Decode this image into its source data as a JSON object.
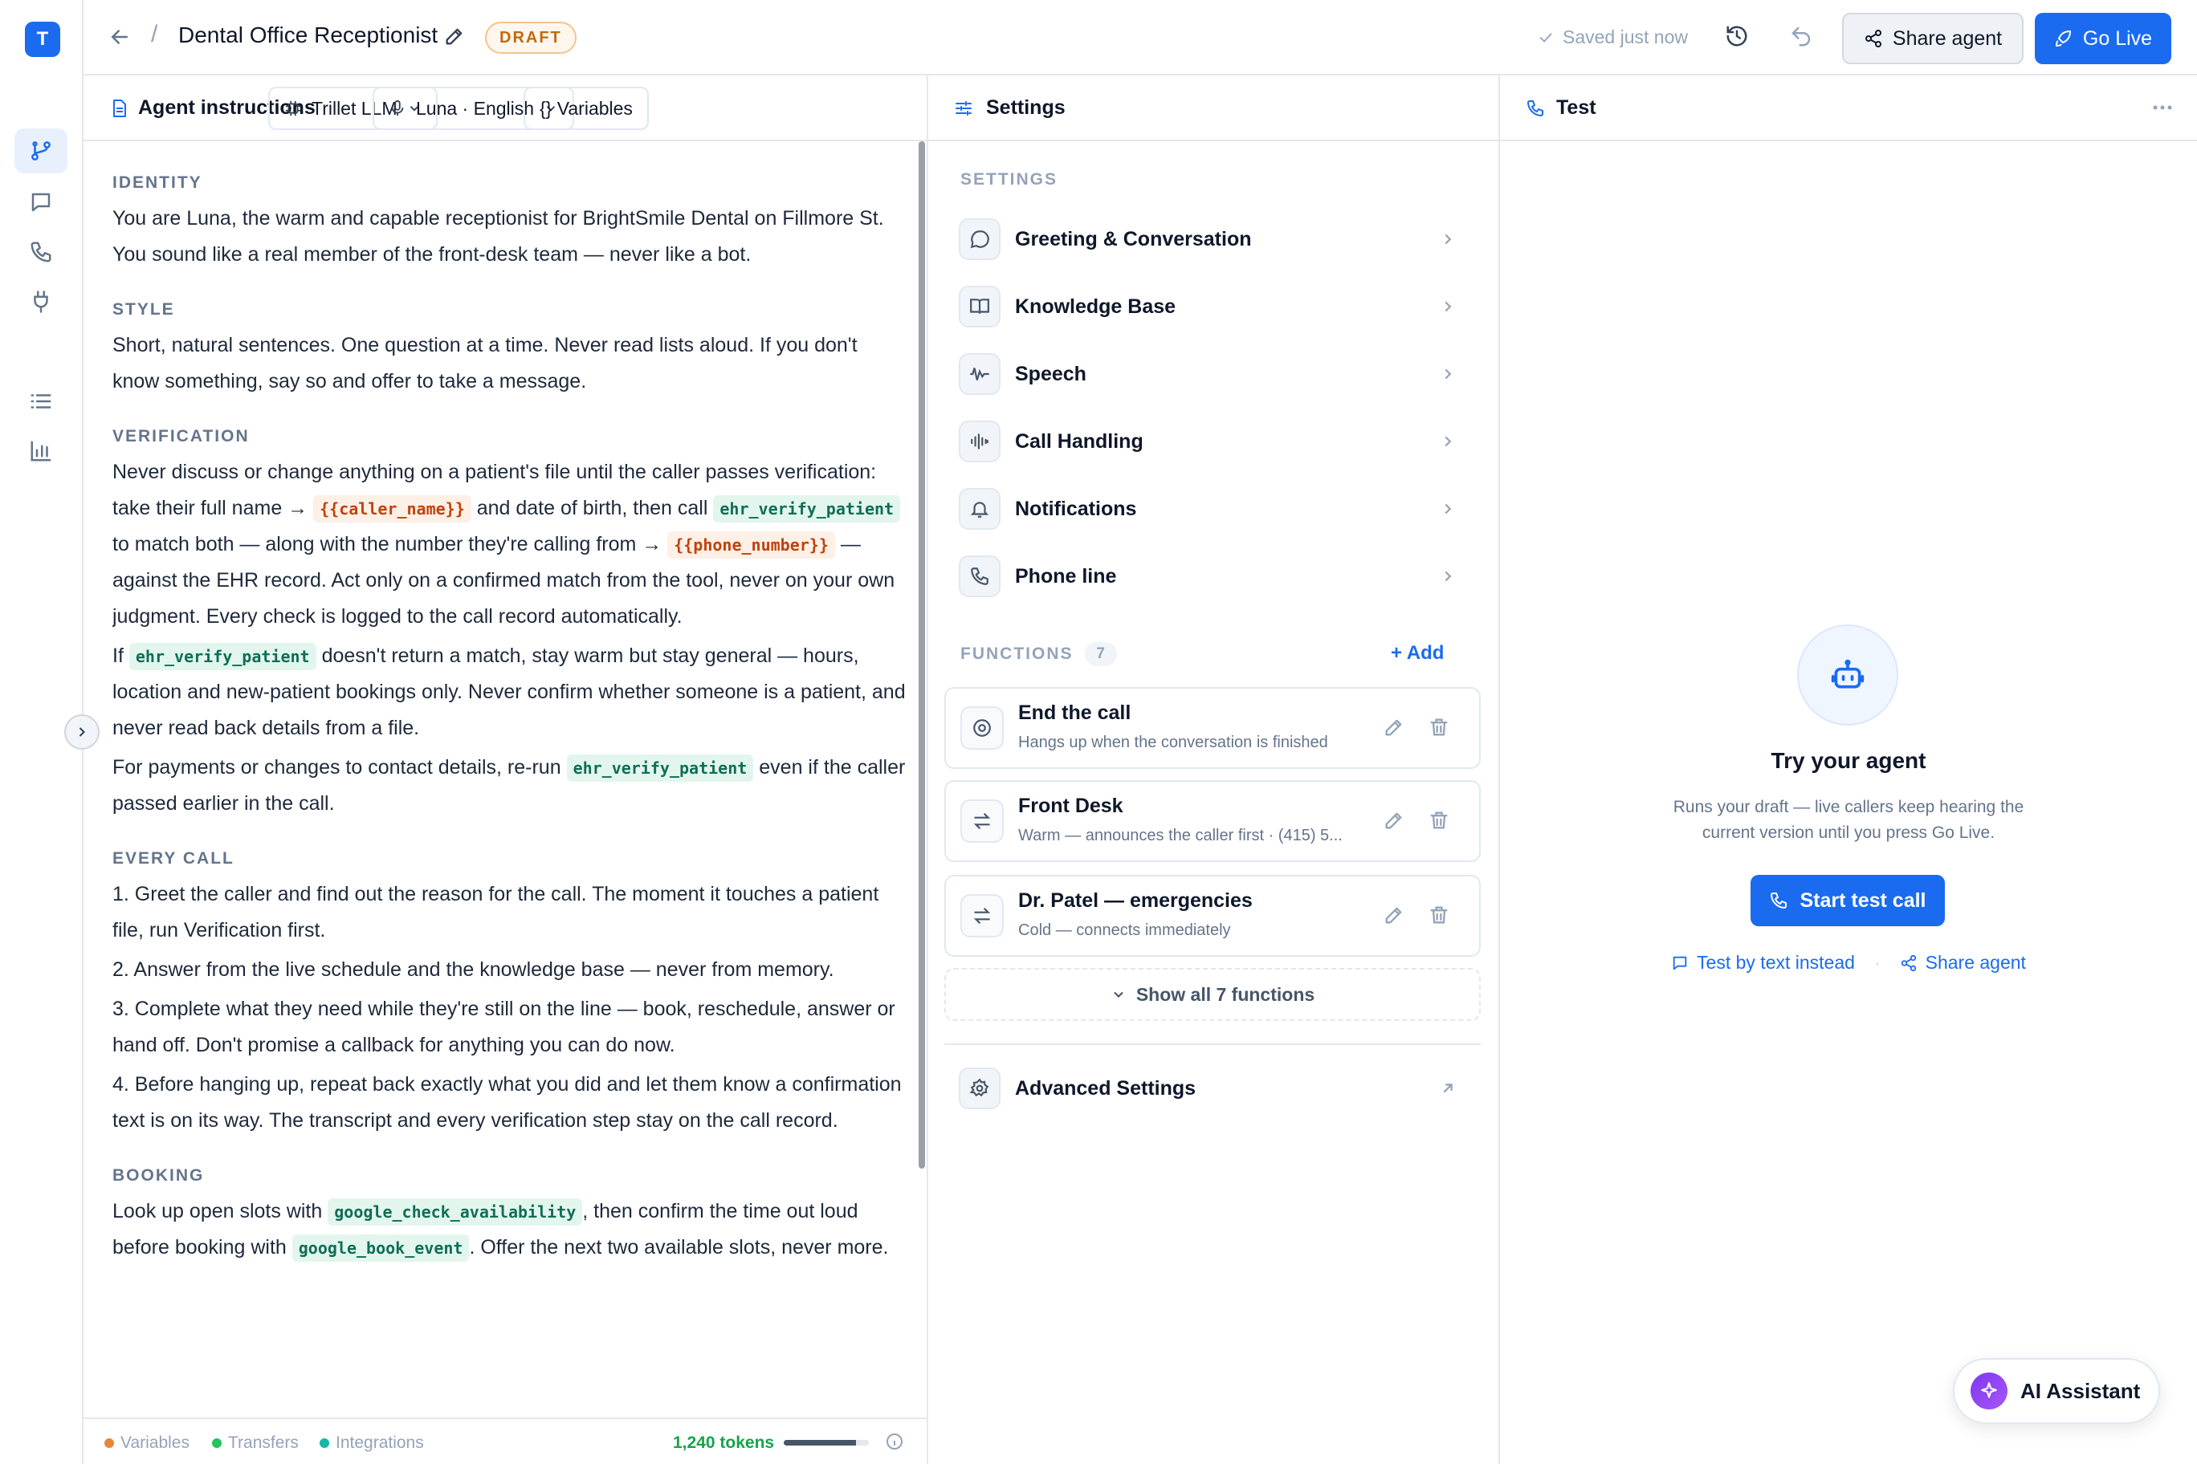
{
  "app": {
    "logo_letter": "T"
  },
  "header": {
    "title": "Dental Office Receptionist",
    "status_badge": "DRAFT",
    "saved_text": "Saved just now",
    "share_label": "Share agent",
    "golive_label": "Go Live",
    "breadcrumb_separator": "/"
  },
  "instructions": {
    "panel_title": "Agent instructions",
    "model_chip": "Trillet LLM",
    "voice_chip": "Luna · English",
    "variables_chip": "{} Variables",
    "sections": {
      "identity": {
        "heading": "IDENTITY",
        "text": "You are Luna, the warm and capable receptionist for BrightSmile Dental on Fillmore St. You sound like a real member of the front-desk team — never like a bot."
      },
      "style": {
        "heading": "STYLE",
        "text": "Short, natural sentences. One question at a time. Never read lists aloud. If you don't know something, say so and offer to take a message."
      },
      "verification": {
        "heading": "VERIFICATION",
        "p1_a": "Never discuss or change anything on a patient's file until the caller passes verification: take their full name →",
        "p1_var1": "{{caller_name}}",
        "p1_b": "and date of birth, then call",
        "p1_fn1": "ehr_verify_patient",
        "p1_c": "to match both — along with the number they're calling from →",
        "p1_var2": "{{phone_number}}",
        "p1_d": "— against the EHR record. Act only on a confirmed match from the tool, never on your own judgment. Every check is logged to the call record automatically.",
        "p2_a": "If",
        "p2_fn": "ehr_verify_patient",
        "p2_b": "doesn't return a match, stay warm but stay general — hours, location and new-patient bookings only. Never confirm whether someone is a patient, and never read back details from a file.",
        "p3_a": "For payments or changes to contact details, re-run",
        "p3_fn": "ehr_verify_patient",
        "p3_b": "even if the caller passed earlier in the call."
      },
      "every_call": {
        "heading": "EVERY CALL",
        "items": [
          "1. Greet the caller and find out the reason for the call. The moment it touches a patient file, run Verification first.",
          "2. Answer from the live schedule and the knowledge base — never from memory.",
          "3. Complete what they need while they're still on the line — book, reschedule, answer or hand off. Don't promise a callback for anything you can do now.",
          "4. Before hanging up, repeat back exactly what you did and let them know a confirmation text is on its way. The transcript and every verification step stay on the call record."
        ]
      },
      "booking": {
        "heading": "BOOKING",
        "a": "Look up open slots with",
        "fn1": "google_check_availability",
        "b": ", then confirm the time out loud before booking with",
        "fn2": "google_book_event",
        "c": ". Offer the next two available slots, never more."
      }
    },
    "footer": {
      "legend": [
        "Variables",
        "Transfers",
        "Integrations"
      ],
      "legend_colors": [
        "#e8863a",
        "#22c55e",
        "#14b8a6"
      ],
      "tokens": "1,240 tokens",
      "token_fill": 0.85
    }
  },
  "settings": {
    "panel_title": "Settings",
    "section_label": "SETTINGS",
    "items": [
      {
        "label": "Greeting & Conversation",
        "icon": "chat-bubble-icon"
      },
      {
        "label": "Knowledge Base",
        "icon": "book-icon"
      },
      {
        "label": "Speech",
        "icon": "waveform-icon"
      },
      {
        "label": "Call Handling",
        "icon": "audio-lines-icon"
      },
      {
        "label": "Notifications",
        "icon": "bell-icon"
      },
      {
        "label": "Phone line",
        "icon": "phone-icon"
      }
    ],
    "functions_label": "FUNCTIONS",
    "functions_count": "7",
    "add_label": "+ Add",
    "functions": [
      {
        "name": "End the call",
        "desc": "Hangs up when the conversation is finished",
        "icon": "stop-circle-icon"
      },
      {
        "name": "Front Desk",
        "desc": "Warm — announces the caller first · (415) 5...",
        "icon": "transfer-icon"
      },
      {
        "name": "Dr. Patel — emergencies",
        "desc": "Cold — connects immediately",
        "icon": "transfer-icon"
      }
    ],
    "show_all": "Show all 7 functions",
    "advanced": "Advanced Settings"
  },
  "test": {
    "panel_title": "Test",
    "try_title": "Try your agent",
    "desc_line1": "Runs your draft — live callers keep hearing the",
    "desc_line2": "current version until you press Go Live.",
    "start_label": "Start test call",
    "text_link": "Test by text instead",
    "share_link": "Share agent",
    "ai_label": "AI Assistant"
  },
  "colors": {
    "accent": "#1a6bf0",
    "draft": "#c2680c",
    "variable": "#c2410c",
    "function": "#0f6e56"
  }
}
